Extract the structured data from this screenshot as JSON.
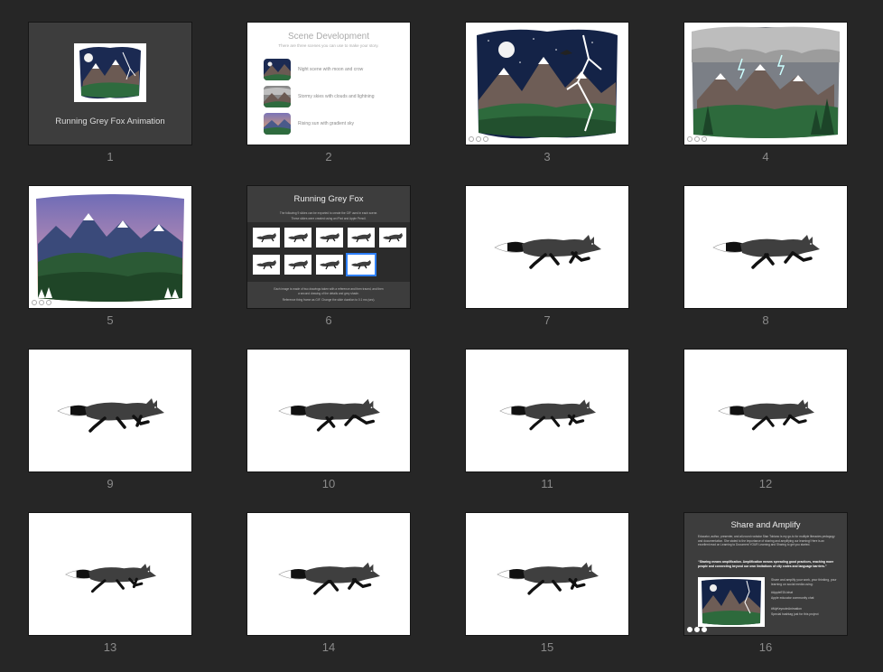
{
  "slides": [
    {
      "number": "1",
      "type": "title",
      "title": "Running Grey Fox Animation"
    },
    {
      "number": "2",
      "type": "scene-dev",
      "title": "Scene Development",
      "subtitle": "There are three scenes you can use to make your story.",
      "items": [
        "Night scene with moon and crow",
        "Stormy skies with clouds and lightning",
        "Rising sun with gradient sky"
      ]
    },
    {
      "number": "3",
      "type": "night-scene"
    },
    {
      "number": "4",
      "type": "storm-scene"
    },
    {
      "number": "5",
      "type": "sunrise-scene"
    },
    {
      "number": "6",
      "type": "overview",
      "title": "Running Grey Fox",
      "text1": "The following 9 slides can be exported to create the GIF used in each scene.",
      "text2": "These slides were created using an iPad and Apple Pencil.",
      "text3": "Each image is made of two drawings taken with a reference and then traced, and then",
      "text4": "a second drawing of the details and grey shade.",
      "text5": "Reference thing frame as GIF. Change the slide duration to 0.1 ms (sec)."
    },
    {
      "number": "7",
      "type": "fox"
    },
    {
      "number": "8",
      "type": "fox"
    },
    {
      "number": "9",
      "type": "fox"
    },
    {
      "number": "10",
      "type": "fox"
    },
    {
      "number": "11",
      "type": "fox"
    },
    {
      "number": "12",
      "type": "fox"
    },
    {
      "number": "13",
      "type": "fox"
    },
    {
      "number": "14",
      "type": "fox"
    },
    {
      "number": "15",
      "type": "fox"
    },
    {
      "number": "16",
      "type": "share",
      "title": "Share and Amplify",
      "para": "Educator, author, presenter, and all-round rockstar Stan Tobiano is my go-to for multiple literacies pedagogy and documentation. She stated to the importance of sharing and amplifying our learning! Here is an excellent read on Learning to Document YOUR Learning and Sharing to get you started.",
      "quote": "“Sharing means amplification. Amplification means spreading good practices, reaching more people and connecting beyond our own limitations of city codes and language barriers.”",
      "r1": "Share and amplify your work, your thinking, your learning on social media using:",
      "r2": "#AppleEDUchat",
      "r3": "Apple educator community chat",
      "r4": "#MyKeynoteAnimation",
      "r5": "Special hashtag just for this project"
    }
  ],
  "colors": {
    "background": "#262626",
    "dark_slide": "#3d3d3d",
    "fox_body": "#3f3f3f",
    "fox_dark": "#111111",
    "selection": "#2d7ff9"
  }
}
